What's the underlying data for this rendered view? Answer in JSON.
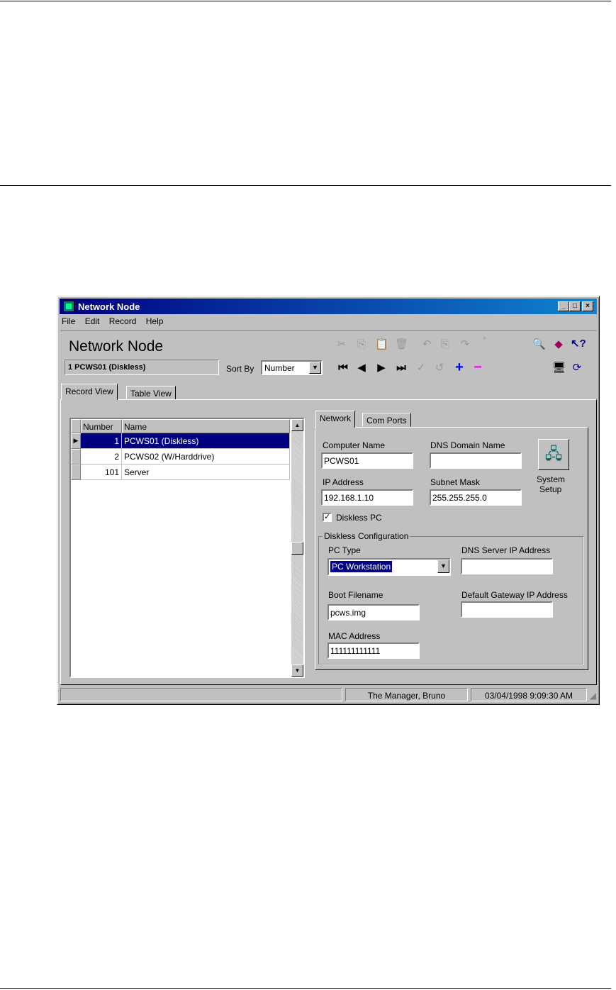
{
  "window": {
    "title": "Network Node"
  },
  "menu": [
    "File",
    "Edit",
    "Record",
    "Help"
  ],
  "header": {
    "title": "Network Node",
    "current_record": "1 PCWS01 (Diskless)",
    "sort_by_label": "Sort By",
    "sort_by_value": "Number"
  },
  "toolbar_icons": [
    "cut-icon",
    "copy-icon",
    "paste-icon",
    "delete-icon",
    "undo-icon",
    "find-icon",
    "help-book-icon",
    "context-help-icon",
    "first-record-icon",
    "prev-record-icon",
    "next-record-icon",
    "last-record-icon",
    "edit-icon",
    "cancel-icon",
    "add-record-icon",
    "remove-record-icon",
    "monitor-icon",
    "refresh-icon"
  ],
  "views": {
    "record": "Record View",
    "table": "Table View"
  },
  "grid": {
    "columns": [
      "Number",
      "Name"
    ],
    "rows": [
      {
        "number": "1",
        "name": "PCWS01 (Diskless)"
      },
      {
        "number": "2",
        "name": "PCWS02 (W/Harddrive)"
      },
      {
        "number": "101",
        "name": "Server"
      }
    ]
  },
  "detail_tabs": {
    "network": "Network",
    "com_ports": "Com Ports"
  },
  "network": {
    "computer_name_label": "Computer Name",
    "computer_name": "PCWS01",
    "dns_domain_label": "DNS Domain Name",
    "dns_domain": "",
    "ip_label": "IP Address",
    "ip": "192.168.1.10",
    "subnet_label": "Subnet Mask",
    "subnet": "255.255.255.0",
    "diskless_label": "Diskless PC",
    "diskless_checked": true,
    "system_setup_line1": "System",
    "system_setup_line2": "Setup"
  },
  "diskless": {
    "group_label": "Diskless Configuration",
    "pc_type_label": "PC Type",
    "pc_type": "PC Workstation",
    "dns_server_label": "DNS Server IP Address",
    "dns_server": "",
    "boot_label": "Boot Filename",
    "boot": "pcws.img",
    "gateway_label": "Default Gateway IP Address",
    "gateway": "",
    "mac_label": "MAC Address",
    "mac": "111111111111"
  },
  "status": {
    "user": "The Manager, Bruno",
    "datetime": "03/04/1998 9:09:30 AM"
  },
  "colors": {
    "titlebar": "#000080",
    "selection": "#000080",
    "add": "#0000ff",
    "remove": "#ff00ff"
  }
}
